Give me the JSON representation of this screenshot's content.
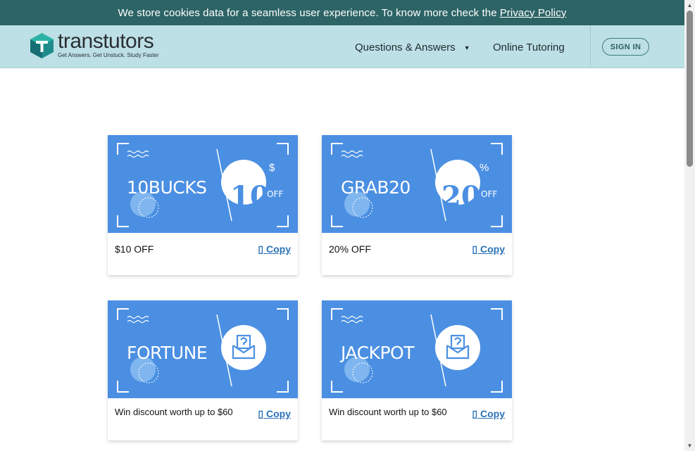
{
  "cookie": {
    "text": "We store cookies data for a seamless user experience. To know more check the",
    "link": "Privacy Policy"
  },
  "header": {
    "brand": "transtutors",
    "tagline": "Get Answers. Get Unstuck. Study Faster",
    "nav_qa": "Questions & Answers",
    "nav_tutoring": "Online Tutoring",
    "sign_in": "SIGN IN"
  },
  "colors": {
    "cookie_bar": "#2d6466",
    "header": "#bde0e6",
    "coupon": "#4b8fe2",
    "link": "#2a72b8"
  },
  "coupons": [
    {
      "code": "10BUCKS",
      "amount": "10",
      "symbol": "$",
      "off": "OFF",
      "description": "$10 OFF",
      "copy": "Copy",
      "icon": "copy-icon"
    },
    {
      "code": "GRAB20",
      "amount": "20",
      "symbol": "%",
      "off": "OFF",
      "description": "20% OFF",
      "copy": "Copy",
      "icon": "copy-icon"
    },
    {
      "code": "FORTUNE",
      "description": "Win discount worth up to $60",
      "copy": "Copy",
      "icon": "mystery-envelope-icon"
    },
    {
      "code": "JACKPOT",
      "description": "Win discount worth up to $60",
      "copy": "Copy",
      "icon": "mystery-envelope-icon"
    }
  ]
}
